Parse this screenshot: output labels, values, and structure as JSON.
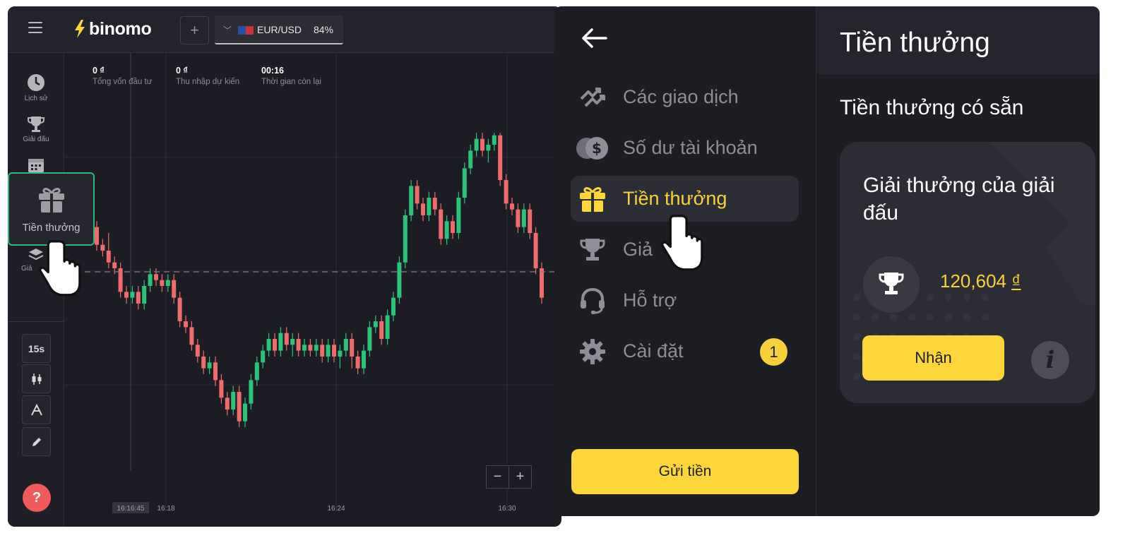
{
  "trading": {
    "brand": "binomo",
    "add_tab": "+",
    "asset": {
      "pair": "EUR/USD",
      "payout": "84%"
    },
    "stats": [
      {
        "value": "0 ₫",
        "label": "Tổng vốn đầu tư"
      },
      {
        "value": "0 ₫",
        "label": "Thu nhập dự kiến"
      },
      {
        "value": "00:16",
        "label": "Thời gian còn lại"
      }
    ],
    "sidebar": {
      "history": "Lịch sử",
      "tournaments": "Giải đấu",
      "bonus": "Tiền thưởng",
      "partial_label": "Giả"
    },
    "tools": {
      "timeframe": "15s"
    },
    "help": "?",
    "zoom": {
      "minus": "−",
      "plus": "+"
    },
    "time_labels": [
      "16:16:45",
      "16:18",
      "16:24",
      "16:30"
    ]
  },
  "chart_data": {
    "type": "candlestick",
    "title": "",
    "xlabel": "",
    "ylabel": "",
    "x_ticks": [
      "16:18",
      "16:24",
      "16:30"
    ],
    "current_time": "16:16:45",
    "colors": {
      "up": "#2bc37a",
      "down": "#f06b6b"
    },
    "candles": [
      [
        1.3,
        1.15,
        1.25,
        1.05
      ],
      [
        1.15,
        1.1,
        1.2,
        1.0
      ],
      [
        1.1,
        1.2,
        1.25,
        1.05
      ],
      [
        1.2,
        1.15,
        1.3,
        1.1
      ],
      [
        1.15,
        1.1,
        1.25,
        1.05
      ],
      [
        1.1,
        0.95,
        1.15,
        0.9
      ],
      [
        0.95,
        0.9,
        1.0,
        0.85
      ],
      [
        0.9,
        0.8,
        1.05,
        0.75
      ],
      [
        0.8,
        0.75,
        0.85,
        0.7
      ],
      [
        0.75,
        0.55,
        0.8,
        0.5
      ],
      [
        0.55,
        0.5,
        0.6,
        0.45
      ],
      [
        0.5,
        0.55,
        0.6,
        0.45
      ],
      [
        0.55,
        0.45,
        0.6,
        0.4
      ],
      [
        0.45,
        0.6,
        0.65,
        0.4
      ],
      [
        0.6,
        0.7,
        0.75,
        0.55
      ],
      [
        0.7,
        0.65,
        0.75,
        0.6
      ],
      [
        0.65,
        0.6,
        0.7,
        0.55
      ],
      [
        0.6,
        0.65,
        0.7,
        0.55
      ],
      [
        0.65,
        0.5,
        0.7,
        0.45
      ],
      [
        0.5,
        0.3,
        0.55,
        0.25
      ],
      [
        0.3,
        0.25,
        0.35,
        0.2
      ],
      [
        0.25,
        0.1,
        0.3,
        0.05
      ],
      [
        0.1,
        0.0,
        0.15,
        -0.05
      ],
      [
        0.0,
        -0.1,
        0.05,
        -0.15
      ],
      [
        -0.1,
        -0.05,
        0.0,
        -0.15
      ],
      [
        -0.05,
        -0.2,
        0.0,
        -0.25
      ],
      [
        -0.2,
        -0.35,
        -0.15,
        -0.4
      ],
      [
        -0.35,
        -0.45,
        -0.3,
        -0.5
      ],
      [
        -0.45,
        -0.3,
        -0.25,
        -0.5
      ],
      [
        -0.3,
        -0.55,
        -0.25,
        -0.6
      ],
      [
        -0.55,
        -0.4,
        -0.35,
        -0.6
      ],
      [
        -0.4,
        -0.2,
        -0.15,
        -0.45
      ],
      [
        -0.2,
        -0.05,
        0.0,
        -0.25
      ],
      [
        -0.05,
        0.05,
        0.1,
        -0.1
      ],
      [
        0.05,
        0.15,
        0.2,
        0.0
      ],
      [
        0.15,
        0.05,
        0.2,
        0.0
      ],
      [
        0.05,
        0.2,
        0.25,
        0.0
      ],
      [
        0.2,
        0.1,
        0.25,
        0.05
      ],
      [
        0.1,
        0.15,
        0.2,
        0.0
      ],
      [
        0.15,
        0.05,
        0.2,
        0.0
      ],
      [
        0.05,
        0.1,
        0.15,
        0.0
      ],
      [
        0.1,
        0.05,
        0.15,
        0.0
      ],
      [
        0.05,
        0.1,
        0.15,
        0.0
      ],
      [
        0.1,
        0.0,
        0.15,
        -0.05
      ],
      [
        0.0,
        0.1,
        0.15,
        -0.05
      ],
      [
        0.1,
        0.0,
        0.15,
        -0.05
      ],
      [
        0.0,
        0.05,
        0.1,
        -0.1
      ],
      [
        0.05,
        0.15,
        0.2,
        0.0
      ],
      [
        0.15,
        0.0,
        0.2,
        -0.1
      ],
      [
        0.0,
        -0.1,
        0.05,
        -0.15
      ],
      [
        -0.1,
        0.05,
        0.1,
        -0.15
      ],
      [
        0.05,
        0.25,
        0.3,
        0.0
      ],
      [
        0.25,
        0.3,
        0.35,
        0.2
      ],
      [
        0.3,
        0.15,
        0.35,
        0.1
      ],
      [
        0.15,
        0.35,
        0.4,
        0.1
      ],
      [
        0.35,
        0.5,
        0.55,
        0.3
      ],
      [
        0.5,
        0.8,
        0.85,
        0.45
      ],
      [
        0.8,
        1.2,
        1.25,
        0.75
      ],
      [
        1.2,
        1.45,
        1.5,
        1.15
      ],
      [
        1.45,
        1.3,
        1.5,
        1.25
      ],
      [
        1.3,
        1.2,
        1.35,
        1.15
      ],
      [
        1.2,
        1.35,
        1.4,
        1.15
      ],
      [
        1.35,
        1.25,
        1.4,
        1.2
      ],
      [
        1.25,
        1.0,
        1.3,
        0.95
      ],
      [
        1.0,
        1.15,
        1.2,
        0.95
      ],
      [
        1.15,
        1.05,
        1.2,
        1.0
      ],
      [
        1.05,
        1.35,
        1.4,
        1.0
      ],
      [
        1.35,
        1.6,
        1.65,
        1.3
      ],
      [
        1.6,
        1.75,
        1.8,
        1.55
      ],
      [
        1.75,
        1.85,
        1.9,
        1.7
      ],
      [
        1.85,
        1.75,
        1.9,
        1.7
      ],
      [
        1.75,
        1.8,
        1.85,
        1.65
      ],
      [
        1.8,
        1.88,
        1.9,
        1.75
      ],
      [
        1.88,
        1.5,
        1.9,
        1.45
      ],
      [
        1.5,
        1.3,
        1.55,
        1.25
      ],
      [
        1.3,
        1.25,
        1.35,
        1.2
      ],
      [
        1.25,
        1.1,
        1.3,
        1.05
      ],
      [
        1.1,
        1.25,
        1.3,
        1.05
      ],
      [
        1.25,
        1.05,
        1.3,
        1.0
      ],
      [
        1.05,
        0.75,
        1.1,
        0.7
      ],
      [
        0.75,
        0.5,
        0.8,
        0.45
      ]
    ],
    "reference_level": 0.72,
    "ylim": [
      -0.9,
      2.4
    ]
  },
  "menu": {
    "items": [
      {
        "label": "Các giao dịch",
        "icon": "trades-icon"
      },
      {
        "label": "Số dư tài khoản",
        "icon": "balance-icon"
      },
      {
        "label": "Tiền thưởng",
        "icon": "gift-icon",
        "active": true
      },
      {
        "label": "Giả",
        "icon": "trophy-icon"
      },
      {
        "label": "Hỗ trợ",
        "icon": "headset-icon"
      },
      {
        "label": "Cài đặt",
        "icon": "gear-icon",
        "badge": "1"
      }
    ],
    "deposit": "Gửi tiền"
  },
  "bonus": {
    "title": "Tiền thưởng",
    "subtitle": "Tiền thưởng có sẵn",
    "card": {
      "title": "Giải thưởng của giải đấu",
      "amount": "120,604",
      "currency": "₫",
      "claim": "Nhận",
      "info": "i"
    }
  },
  "colors": {
    "accent": "#fdd63a",
    "highlight": "#2fb67c",
    "up": "#2bc37a",
    "down": "#f06b6b"
  }
}
